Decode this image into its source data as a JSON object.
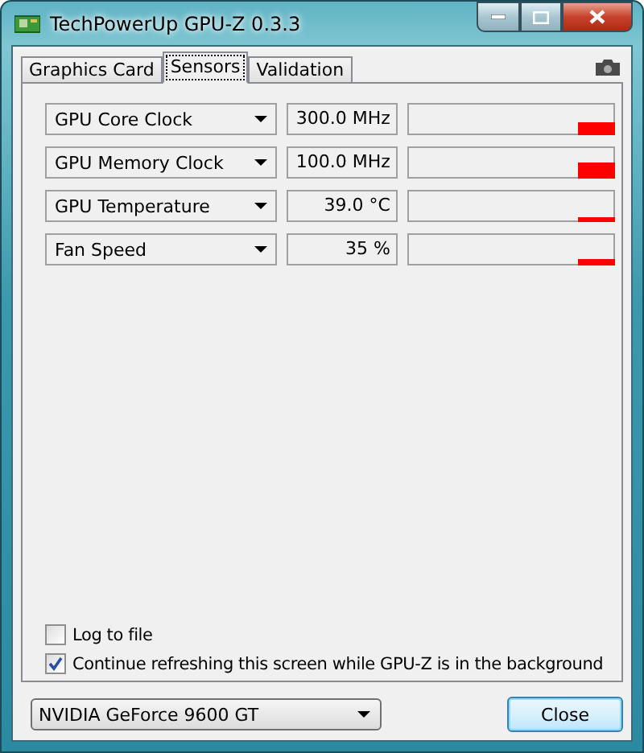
{
  "window": {
    "title": "TechPowerUp GPU-Z 0.3.3"
  },
  "tabs": [
    {
      "label": "Graphics Card",
      "selected": false
    },
    {
      "label": "Sensors",
      "selected": true
    },
    {
      "label": "Validation",
      "selected": false
    }
  ],
  "sensors": [
    {
      "name": "GPU Core Clock",
      "reading": "300.0 MHz"
    },
    {
      "name": "GPU Memory Clock",
      "reading": "100.0 MHz"
    },
    {
      "name": "GPU Temperature",
      "reading": "39.0 °C"
    },
    {
      "name": "Fan Speed",
      "reading": "35 %"
    }
  ],
  "options": [
    {
      "label": "Log to file",
      "checked": false
    },
    {
      "label": "Continue refreshing this screen while GPU-Z is in the background",
      "checked": true
    }
  ],
  "device_select": {
    "value": "NVIDIA GeForce 9600 GT"
  },
  "buttons": [
    {
      "label": "Close"
    }
  ]
}
